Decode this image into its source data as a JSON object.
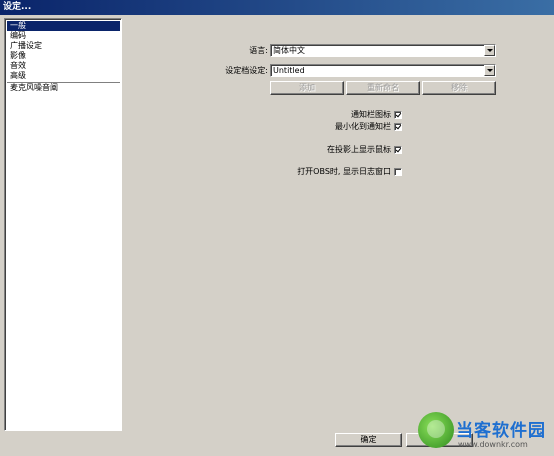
{
  "window": {
    "title": "设定..."
  },
  "sidebar": {
    "items": [
      {
        "label": "一般"
      },
      {
        "label": "编码"
      },
      {
        "label": "广播设定"
      },
      {
        "label": "影像"
      },
      {
        "label": "音效"
      },
      {
        "label": "高级"
      },
      {
        "label": "麦克风噪音阐"
      }
    ],
    "selected_index": 0
  },
  "general": {
    "language_label": "语言:",
    "language_value": "简体中文",
    "profile_label": "设定档设定:",
    "profile_value": "Untitled",
    "add_label": "添加",
    "rename_label": "重新命名",
    "remove_label": "移除",
    "tray_icon_label": "通知栏图标",
    "tray_icon_checked": true,
    "minimize_tray_label": "最小化到通知栏",
    "minimize_tray_checked": true,
    "show_cursor_label": "在投影上显示鼠标",
    "show_cursor_checked": true,
    "open_log_label": "打开OBS时, 显示日志窗口",
    "open_log_checked": false
  },
  "footer": {
    "ok_label": "确定",
    "apply_label": "取"
  },
  "watermark": {
    "brand": "当客软件园",
    "url": "www.downkr.com"
  }
}
